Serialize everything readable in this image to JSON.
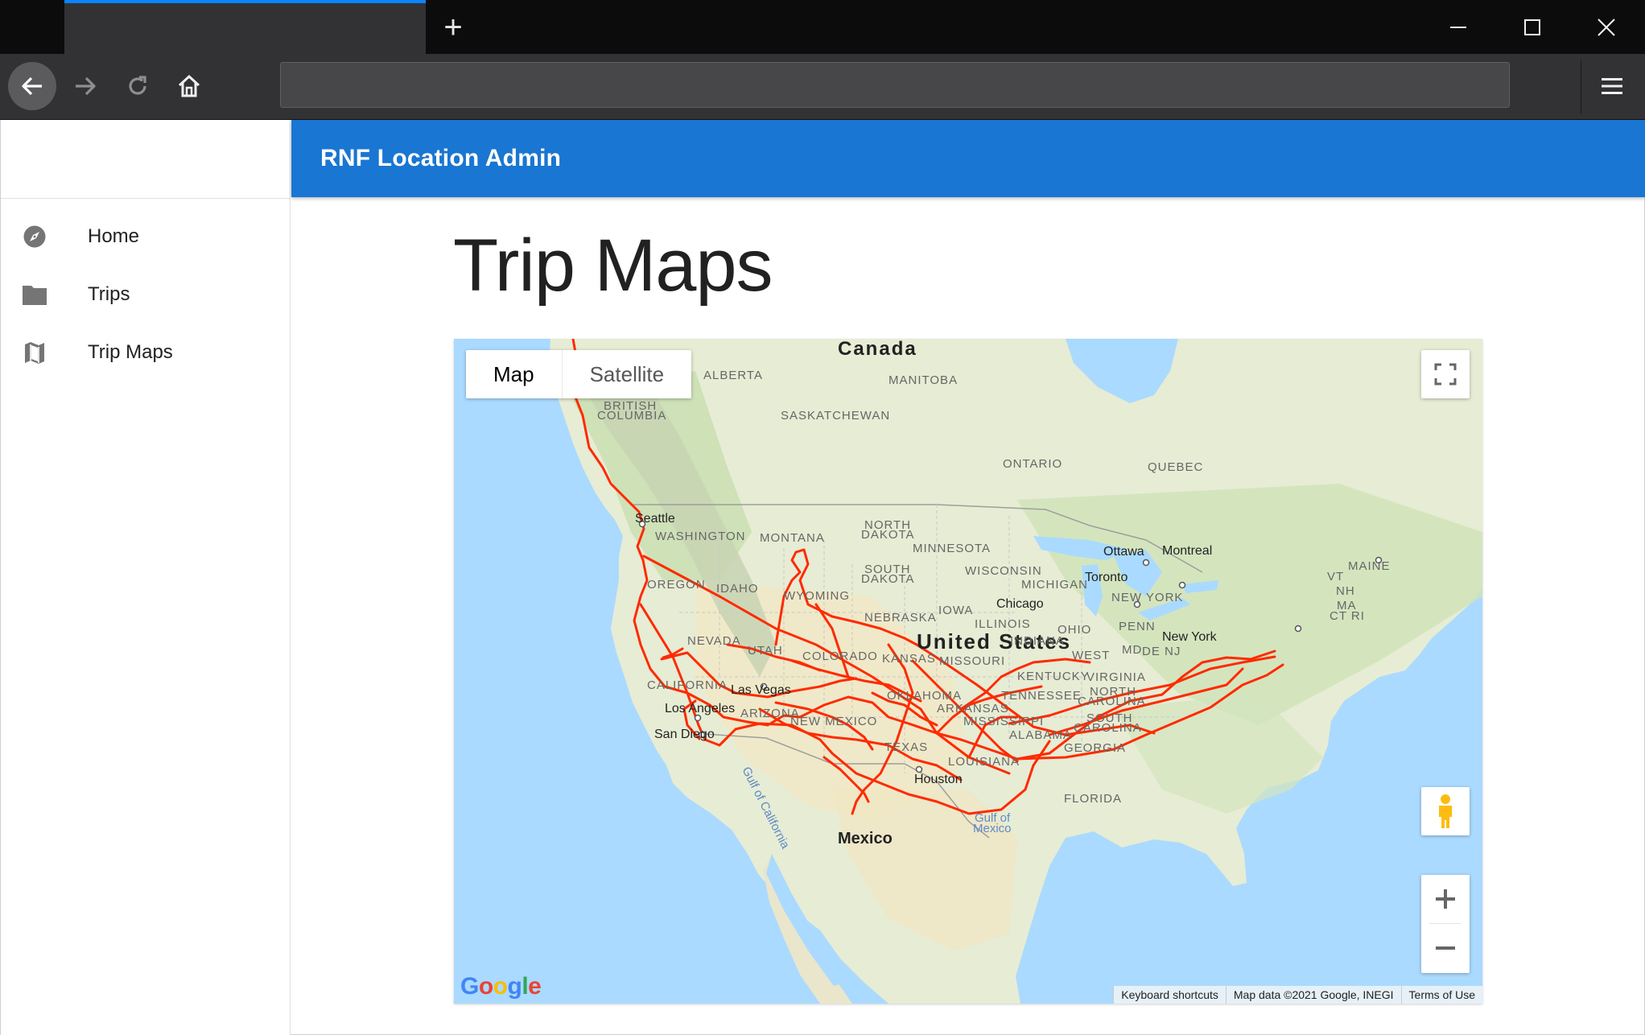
{
  "browser": {
    "url": ""
  },
  "app": {
    "title": "RNF Location Admin",
    "nav": [
      {
        "label": "Home",
        "icon": "compass-icon"
      },
      {
        "label": "Trips",
        "icon": "folder-icon"
      },
      {
        "label": "Trip Maps",
        "icon": "map-icon"
      }
    ]
  },
  "page": {
    "title": "Trip Maps"
  },
  "map": {
    "type_controls": {
      "map": "Map",
      "satellite": "Satellite",
      "selected": "Map"
    },
    "route_color": "#ff2a00",
    "labels": {
      "canada": "Canada",
      "united_states": "United States",
      "mexico": "Mexico",
      "alberta": "ALBERTA",
      "manitoba": "MANITOBA",
      "british_columbia_1": "BRITISH",
      "british_columbia_2": "COLUMBIA",
      "saskatchewan": "SASKATCHEWAN",
      "ontario": "ONTARIO",
      "quebec": "QUEBEC",
      "seattle": "Seattle",
      "washington": "WASHINGTON",
      "montana": "MONTANA",
      "north_dakota_1": "NORTH",
      "north_dakota_2": "DAKOTA",
      "minnesota": "MINNESOTA",
      "ottawa": "Ottawa",
      "montreal": "Montreal",
      "maine": "MAINE",
      "oregon": "OREGON",
      "idaho": "IDAHO",
      "wyoming": "WYOMING",
      "south_dakota_1": "SOUTH",
      "south_dakota_2": "DAKOTA",
      "wisconsin": "WISCONSIN",
      "michigan": "MICHIGAN",
      "toronto": "Toronto",
      "vt": "VT",
      "nh": "NH",
      "new_york_state": "NEW YORK",
      "ma": "MA",
      "ct_ri": "CT RI",
      "chicago": "Chicago",
      "iowa": "IOWA",
      "nebraska": "NEBRASKA",
      "illinois": "ILLINOIS",
      "ohio": "OHIO",
      "penn": "PENN",
      "indiana": "INDIANA",
      "nevada": "NEVADA",
      "utah": "UTAH",
      "colorado": "COLORADO",
      "kansas": "KANSAS",
      "missouri": "MISSOURI",
      "new_york_city": "New York",
      "md": "MD",
      "de_nj": "DE NJ",
      "west_virginia": "WEST",
      "virginia": "VIRGINIA",
      "kentucky": "KENTUCKY",
      "california": "CALIFORNIA",
      "las_vegas": "Las Vegas",
      "oklahoma": "OKLAHOMA",
      "tennessee": "TENNESSEE",
      "north_carolina_1": "NORTH",
      "north_carolina_2": "CAROLINA",
      "los_angeles": "Los Angeles",
      "arizona": "ARIZONA",
      "new_mexico": "NEW MEXICO",
      "arkansas": "ARKANSAS",
      "mississippi": "MISSISSIPPI",
      "south_carolina_1": "SOUTH",
      "south_carolina_2": "CAROLINA",
      "san_diego": "San Diego",
      "texas": "TEXAS",
      "alabama": "ALABAMA",
      "georgia": "GEORGIA",
      "louisiana": "LOUISIANA",
      "houston": "Houston",
      "florida": "FLORIDA",
      "gulf_of_california": "Gulf of California",
      "gulf_of_mexico_1": "Gulf of",
      "gulf_of_mexico_2": "Mexico"
    },
    "google_logo": "Google",
    "attribution": {
      "shortcuts": "Keyboard shortcuts",
      "data": "Map data ©2021 Google, INEGI",
      "terms": "Terms of Use"
    }
  }
}
